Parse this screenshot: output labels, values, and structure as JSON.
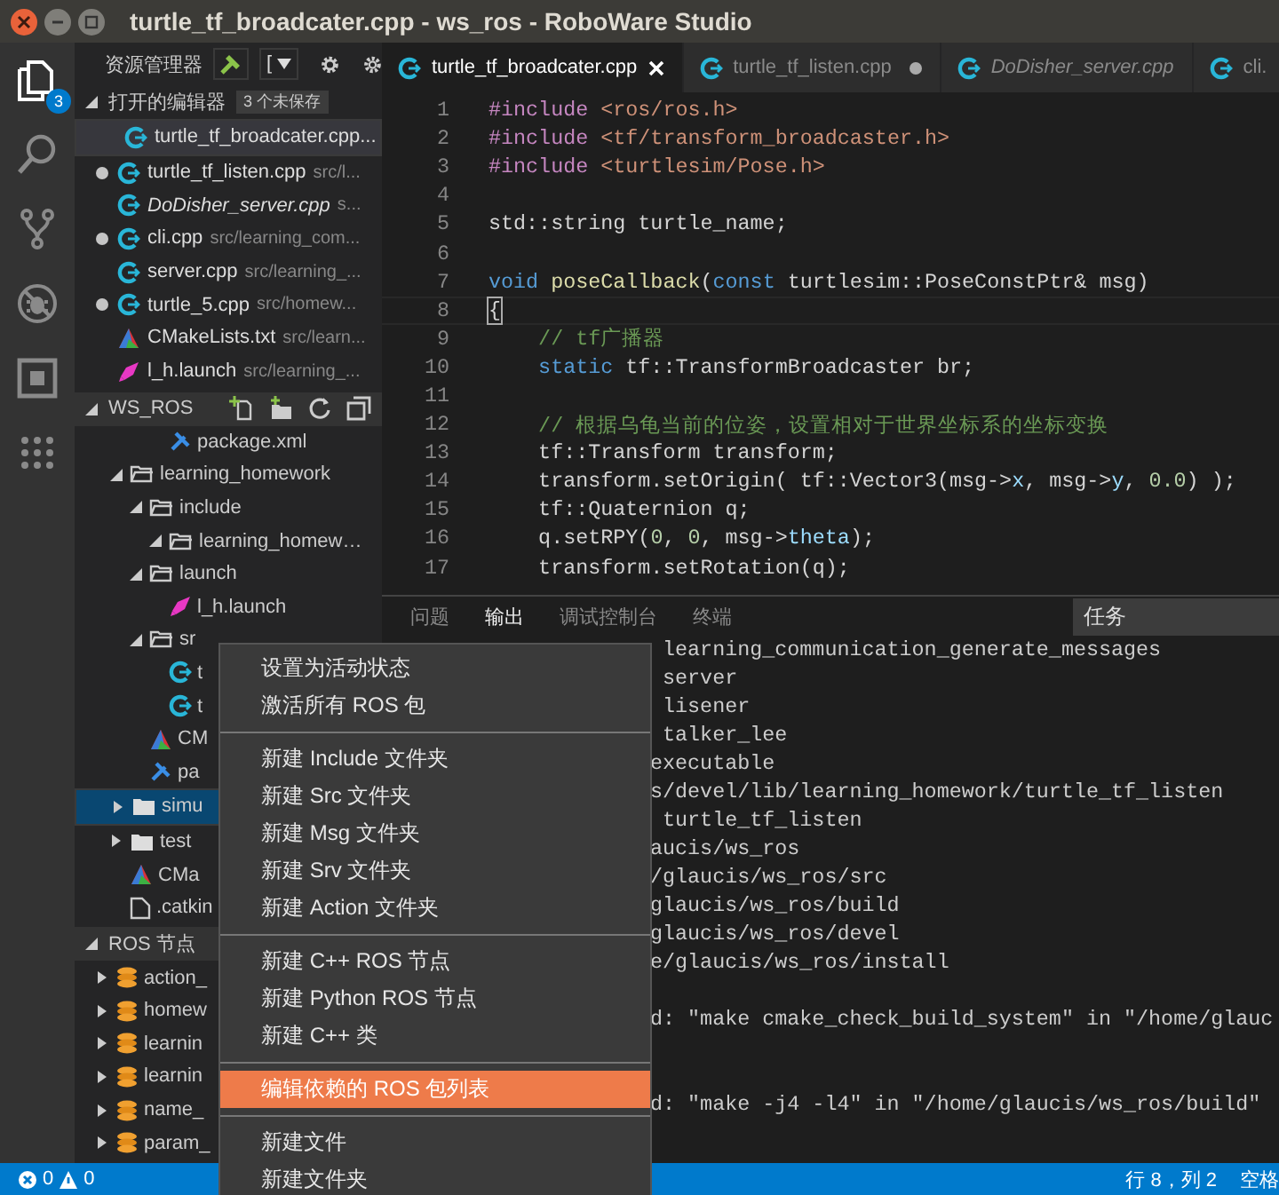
{
  "window": {
    "title": "turtle_tf_broadcater.cpp - ws_ros - RoboWare Studio"
  },
  "activity_bar": [
    {
      "kind": "files",
      "selected": true,
      "badge": "3"
    },
    {
      "kind": "search",
      "selected": false
    },
    {
      "kind": "git",
      "selected": false
    },
    {
      "kind": "debug",
      "selected": false
    },
    {
      "kind": "extensions",
      "selected": false
    },
    {
      "kind": "grid",
      "selected": false
    }
  ],
  "sidebar": {
    "title": "资源管理器",
    "selector": "[",
    "open_editors": {
      "title": "打开的编辑器",
      "badge": "3 个未保存",
      "items": [
        {
          "name": "turtle_tf_broadcater.cpp...",
          "kind": "cpp",
          "modified": false,
          "preview": false,
          "selected": true
        },
        {
          "name": "turtle_tf_listen.cpp",
          "path": "src/l...",
          "kind": "cpp",
          "modified": true,
          "preview": false,
          "selected": false
        },
        {
          "name": "DoDisher_server.cpp",
          "path": "s...",
          "kind": "cpp",
          "modified": false,
          "preview": true,
          "selected": false
        },
        {
          "name": "cli.cpp",
          "path": "src/learning_com...",
          "kind": "cpp",
          "modified": true,
          "preview": false,
          "selected": false
        },
        {
          "name": "server.cpp",
          "path": "src/learning_...",
          "kind": "cpp",
          "modified": false,
          "preview": false,
          "selected": false
        },
        {
          "name": "turtle_5.cpp",
          "path": "src/homew...",
          "kind": "cpp",
          "modified": true,
          "preview": false,
          "selected": false
        },
        {
          "name": "CMakeLists.txt",
          "path": "src/learn...",
          "kind": "cmake",
          "modified": false,
          "preview": false,
          "selected": false
        },
        {
          "name": "l_h.launch",
          "path": "src/learning_...",
          "kind": "launch",
          "modified": false,
          "preview": false,
          "selected": false
        }
      ]
    },
    "workspace": {
      "title": "WS_ROS",
      "continued": [
        {
          "name": "package.xml",
          "kind": "xml",
          "selected": false
        }
      ],
      "tree": [
        {
          "name": "learning_homework",
          "kind": "folder",
          "expanded": true,
          "selected": false,
          "children": [
            {
              "name": "include",
              "kind": "folder",
              "expanded": true,
              "selected": false,
              "children": [
                {
                  "name": "learning_homew…",
                  "kind": "folder",
                  "expanded": true,
                  "selected": false
                }
              ]
            },
            {
              "name": "launch",
              "kind": "folder",
              "expanded": true,
              "selected": false,
              "children": [
                {
                  "name": "l_h.launch",
                  "kind": "launch",
                  "selected": false
                }
              ]
            },
            {
              "name": "sr",
              "kind": "folder",
              "expanded": true,
              "selected": false,
              "children": [
                {
                  "name": "t",
                  "kind": "cpp",
                  "selected": false
                },
                {
                  "name": "t",
                  "kind": "cpp",
                  "selected": false
                }
              ]
            },
            {
              "name": "CM",
              "kind": "cmake",
              "selected": false
            },
            {
              "name": "pa",
              "kind": "xml",
              "selected": false
            }
          ]
        },
        {
          "name": "simu",
          "kind": "folder",
          "expanded": false,
          "selected": true
        },
        {
          "name": "test",
          "kind": "folder",
          "expanded": false,
          "selected": false
        },
        {
          "name": "CMa",
          "kind": "cmake",
          "selected": false
        },
        {
          "name": ".catkin",
          "kind": "file",
          "selected": false
        }
      ]
    },
    "ros_nodes": {
      "title": "ROS 节点",
      "items": [
        {
          "name": "action_",
          "expanded": false
        },
        {
          "name": "homew",
          "expanded": false
        },
        {
          "name": "learnin",
          "expanded": false
        },
        {
          "name": "learnin",
          "expanded": false
        },
        {
          "name": "name_",
          "expanded": false
        },
        {
          "name": "param_",
          "expanded": false
        }
      ]
    }
  },
  "editor": {
    "tabs": [
      {
        "label": "turtle_tf_broadcater.cpp",
        "selected": true,
        "modified": false,
        "preview": false
      },
      {
        "label": "turtle_tf_listen.cpp",
        "selected": false,
        "modified": true,
        "preview": false
      },
      {
        "label": "DoDisher_server.cpp",
        "selected": false,
        "modified": false,
        "preview": true
      },
      {
        "label": "cli.",
        "selected": false,
        "modified": false,
        "preview": false
      }
    ],
    "lines": [
      {
        "n": "1",
        "tokens": [
          {
            "kind": "preprocessor",
            "text": "#include "
          },
          {
            "kind": "string",
            "text": "<ros/ros.h>"
          }
        ]
      },
      {
        "n": "2",
        "tokens": [
          {
            "kind": "preprocessor",
            "text": "#include "
          },
          {
            "kind": "string",
            "text": "<tf/transform_broadcaster.h>"
          }
        ]
      },
      {
        "n": "3",
        "tokens": [
          {
            "kind": "preprocessor",
            "text": "#include "
          },
          {
            "kind": "string",
            "text": "<turtlesim/Pose.h>"
          }
        ]
      },
      {
        "n": "4"
      },
      {
        "n": "5",
        "tokens": [
          {
            "kind": "plain",
            "text": "std::string turtle_name;"
          }
        ]
      },
      {
        "n": "6"
      },
      {
        "n": "7",
        "tokens": [
          {
            "kind": "keyword",
            "text": "void "
          },
          {
            "kind": "function",
            "text": "poseCallback"
          },
          {
            "kind": "plain",
            "text": "("
          },
          {
            "kind": "keyword",
            "text": "const"
          },
          {
            "kind": "plain",
            "text": " turtlesim::PoseConstPtr& msg)"
          }
        ]
      },
      {
        "n": "8",
        "current": true,
        "tokens": [
          {
            "kind": "plain",
            "text": "{"
          }
        ]
      },
      {
        "n": "9",
        "tokens": [
          {
            "kind": "comment",
            "text": "    // tf广播器"
          }
        ]
      },
      {
        "n": "10",
        "tokens": [
          {
            "kind": "keyword",
            "text": "    static"
          },
          {
            "kind": "plain",
            "text": " tf::TransformBroadcaster br;"
          }
        ]
      },
      {
        "n": "11"
      },
      {
        "n": "12",
        "tokens": [
          {
            "kind": "comment",
            "text": "    // 根据乌龟当前的位姿，设置相对于世界坐标系的坐标变换"
          }
        ]
      },
      {
        "n": "13",
        "tokens": [
          {
            "kind": "plain",
            "text": "    tf::Transform transform;"
          }
        ]
      },
      {
        "n": "14",
        "tokens": [
          {
            "kind": "plain",
            "text": "    transform.setOrigin( tf::Vector3(msg->"
          },
          {
            "kind": "variable",
            "text": "x"
          },
          {
            "kind": "plain",
            "text": ", msg->"
          },
          {
            "kind": "variable",
            "text": "y"
          },
          {
            "kind": "plain",
            "text": ", "
          },
          {
            "kind": "number",
            "text": "0.0"
          },
          {
            "kind": "plain",
            "text": ") );"
          }
        ]
      },
      {
        "n": "15",
        "tokens": [
          {
            "kind": "plain",
            "text": "    tf::Quaternion q;"
          }
        ]
      },
      {
        "n": "16",
        "tokens": [
          {
            "kind": "plain",
            "text": "    q.setRPY("
          },
          {
            "kind": "number",
            "text": "0"
          },
          {
            "kind": "plain",
            "text": ", "
          },
          {
            "kind": "number",
            "text": "0"
          },
          {
            "kind": "plain",
            "text": ", msg->"
          },
          {
            "kind": "variable",
            "text": "theta"
          },
          {
            "kind": "plain",
            "text": ");"
          }
        ]
      },
      {
        "n": "17",
        "tokens": [
          {
            "kind": "plain",
            "text": "    transform.setRotation(q);"
          }
        ]
      }
    ]
  },
  "panel": {
    "tabs": [
      {
        "label": "问题",
        "selected": false
      },
      {
        "label": "输出",
        "selected": true
      },
      {
        "label": "调试控制台",
        "selected": false
      },
      {
        "label": "终端",
        "selected": false
      }
    ],
    "task_select": "任务",
    "output_lines": [
      {
        "text": " learning_communication_generate_messages"
      },
      {
        "text": " server"
      },
      {
        "text": " lisener"
      },
      {
        "text": " talker_lee"
      },
      {
        "text": "executable"
      },
      {
        "text": "s/devel/lib/learning_homework/turtle_tf_listen"
      },
      {
        "text": " turtle_tf_listen"
      },
      {
        "text": "aucis/ws_ros"
      },
      {
        "text": "/glaucis/ws_ros/src"
      },
      {
        "text": "glaucis/ws_ros/build"
      },
      {
        "text": "glaucis/ws_ros/devel"
      },
      {
        "text": "e/glaucis/ws_ros/install"
      },
      {
        "text": "d: \"make cmake_check_build_system\" in \"/home/glauc",
        "kind": "spaced"
      },
      {
        "text": "d: \"make -j4 -l4\" in \"/home/glaucis/ws_ros/build\"",
        "kind": "double_spaced"
      }
    ]
  },
  "context_menu": {
    "groups": [
      [
        {
          "label": "设置为活动状态",
          "selected": false
        },
        {
          "label": "激活所有 ROS 包",
          "selected": false
        }
      ],
      [
        {
          "label": "新建 Include 文件夹",
          "selected": false
        },
        {
          "label": "新建 Src 文件夹",
          "selected": false
        },
        {
          "label": "新建 Msg 文件夹",
          "selected": false
        },
        {
          "label": "新建 Srv 文件夹",
          "selected": false
        },
        {
          "label": "新建 Action 文件夹",
          "selected": false
        }
      ],
      [
        {
          "label": "新建 C++ ROS 节点",
          "selected": false
        },
        {
          "label": "新建 Python ROS 节点",
          "selected": false
        },
        {
          "label": "新建 C++ 类",
          "selected": false
        }
      ],
      [
        {
          "label": "编辑依赖的 ROS 包列表",
          "selected": true
        }
      ],
      [
        {
          "label": "新建文件",
          "selected": false
        },
        {
          "label": "新建文件夹",
          "selected": false
        }
      ]
    ]
  },
  "status_bar": {
    "errors": "0",
    "warnings": "0",
    "position": "行 8，列 2",
    "indent": "空格"
  }
}
